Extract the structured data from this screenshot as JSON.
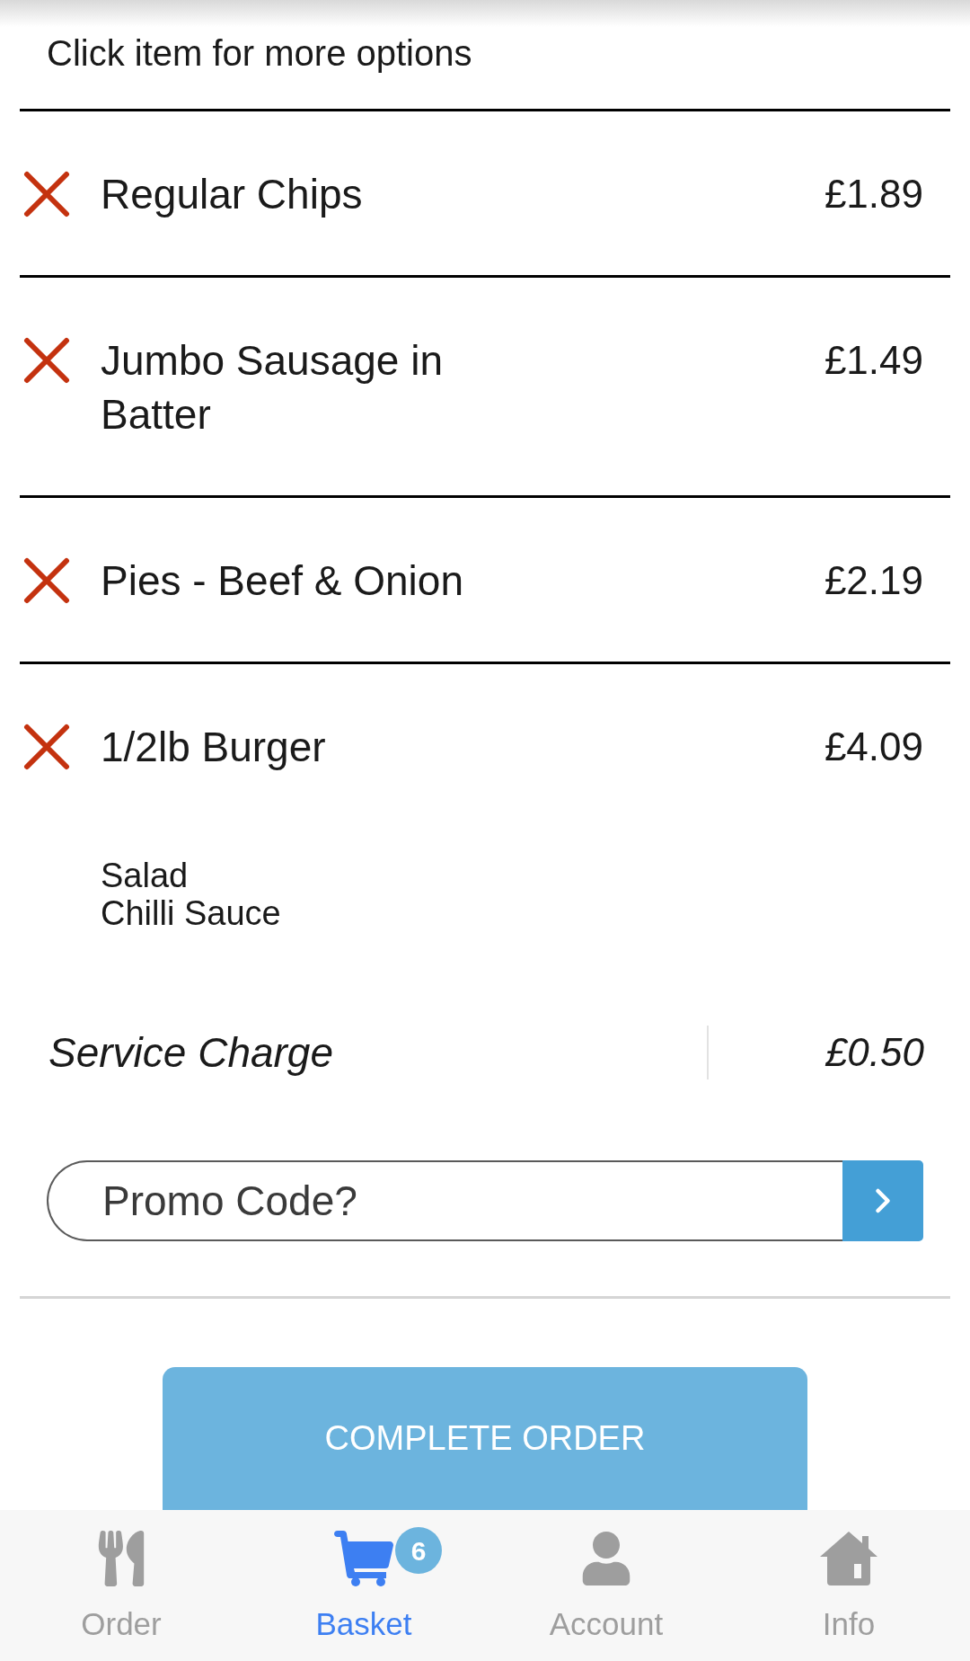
{
  "instructions": "Click item for more options",
  "items": [
    {
      "name": "Regular Chips",
      "price": "£1.89"
    },
    {
      "name": "Jumbo Sausage in Batter",
      "price": "£1.49"
    },
    {
      "name": "Pies - Beef & Onion",
      "price": "£2.19"
    },
    {
      "name": "1/2lb Burger",
      "price": "£4.09",
      "options": [
        "Salad",
        "Chilli Sauce"
      ]
    }
  ],
  "service_charge": {
    "label": "Service Charge",
    "amount": "£0.50"
  },
  "promo": {
    "placeholder": "Promo Code?"
  },
  "complete_button": "COMPLETE ORDER",
  "tab_bar": [
    {
      "kind": "order",
      "label": "Order",
      "selected": false
    },
    {
      "kind": "basket",
      "label": "Basket",
      "selected": true,
      "badge": "6"
    },
    {
      "kind": "account",
      "label": "Account",
      "selected": false
    },
    {
      "kind": "info",
      "label": "Info",
      "selected": false
    }
  ]
}
